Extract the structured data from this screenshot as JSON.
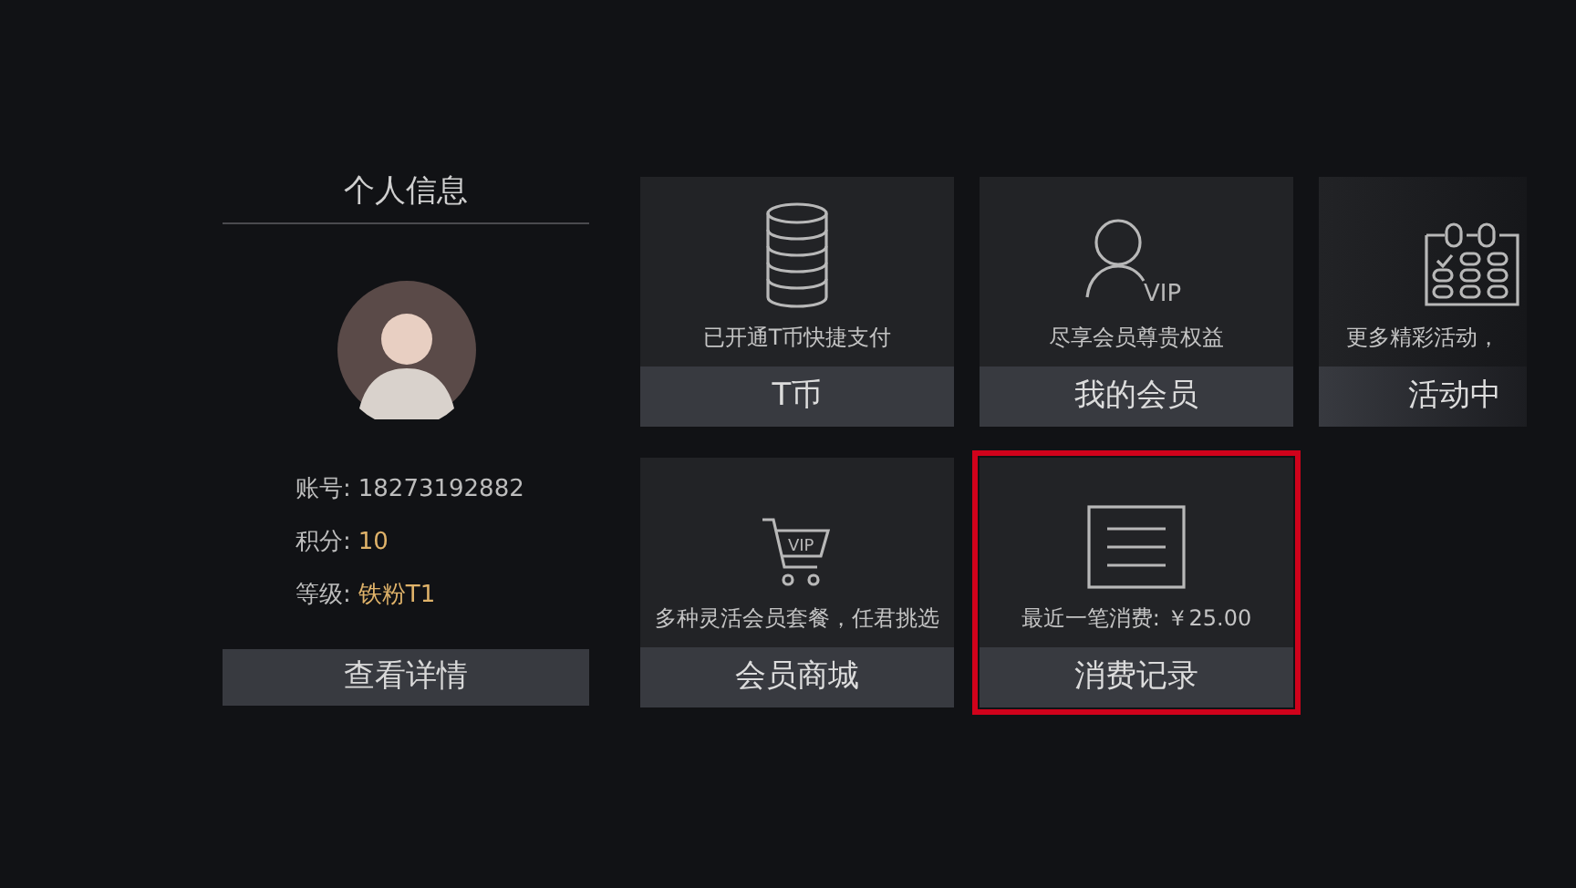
{
  "profile": {
    "title": "个人信息",
    "fields": [
      {
        "label": "账号:",
        "value": "18273192882",
        "highlight": false
      },
      {
        "label": "积分:",
        "value": "10",
        "highlight": true
      },
      {
        "label": "等级:",
        "value": "铁粉T1",
        "highlight": true
      }
    ],
    "button": "查看详情"
  },
  "tiles": [
    {
      "kind": "coins",
      "caption": "已开通T币快捷支付",
      "label": "T币",
      "selected": false,
      "cut": false
    },
    {
      "kind": "vip-user",
      "icon_text": "VIP",
      "caption": "尽享会员尊贵权益",
      "label": "我的会员",
      "selected": false,
      "cut": false
    },
    {
      "kind": "calendar",
      "caption": "更多精彩活动，",
      "label": "活动中",
      "selected": false,
      "cut": true
    },
    {
      "kind": "cart",
      "icon_text": "VIP",
      "caption": "多种灵活会员套餐，任君挑选",
      "label": "会员商城",
      "selected": false,
      "cut": false
    },
    {
      "kind": "list",
      "caption": "最近一笔消费: ￥25.00",
      "label": "消费记录",
      "selected": true,
      "cut": false
    }
  ]
}
